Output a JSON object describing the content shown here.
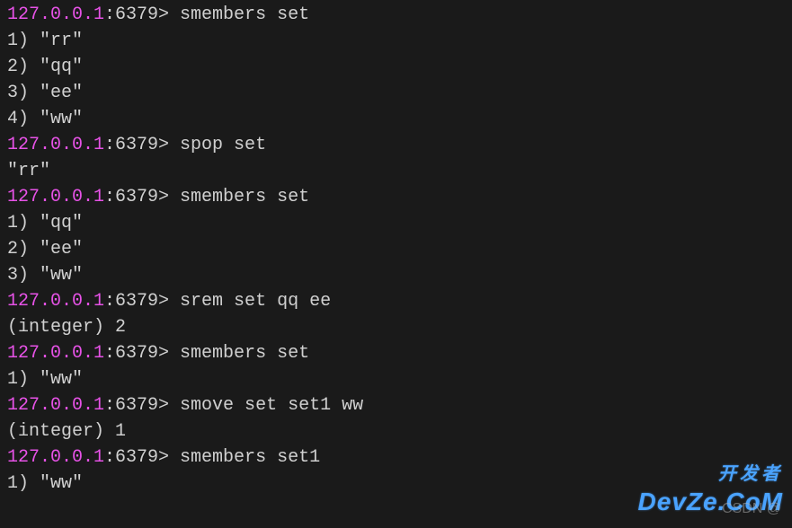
{
  "prompt": {
    "host": "127.0.0.1",
    "port": ":6379>"
  },
  "lines": [
    {
      "type": "cmd",
      "text": " smembers set"
    },
    {
      "type": "out",
      "text": "1) \"rr\""
    },
    {
      "type": "out",
      "text": "2) \"qq\""
    },
    {
      "type": "out",
      "text": "3) \"ee\""
    },
    {
      "type": "out",
      "text": "4) \"ww\""
    },
    {
      "type": "cmd",
      "text": " spop set"
    },
    {
      "type": "out",
      "text": "\"rr\""
    },
    {
      "type": "cmd",
      "text": " smembers set"
    },
    {
      "type": "out",
      "text": "1) \"qq\""
    },
    {
      "type": "out",
      "text": "2) \"ee\""
    },
    {
      "type": "out",
      "text": "3) \"ww\""
    },
    {
      "type": "cmd",
      "text": " srem set qq ee"
    },
    {
      "type": "out",
      "text": "(integer) 2"
    },
    {
      "type": "cmd",
      "text": " smembers set"
    },
    {
      "type": "out",
      "text": "1) \"ww\""
    },
    {
      "type": "cmd",
      "text": " smove set set1 ww"
    },
    {
      "type": "out",
      "text": "(integer) 1"
    },
    {
      "type": "cmd",
      "text": " smembers set1"
    },
    {
      "type": "out",
      "text": "1) \"ww\""
    }
  ],
  "watermark": {
    "csdn": "CSDN @",
    "logo_cn": "开发者",
    "logo_en": "DevZe.CoM"
  }
}
